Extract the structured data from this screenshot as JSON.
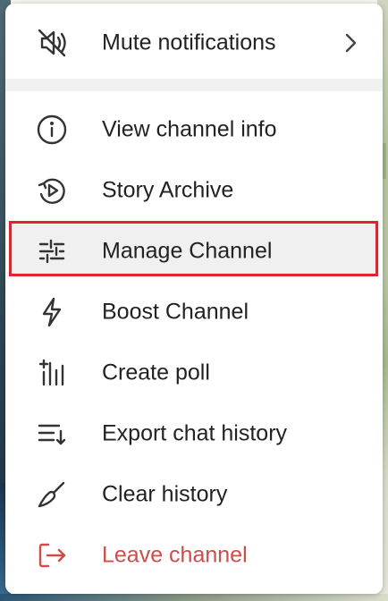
{
  "colors": {
    "text": "#222222",
    "icon": "#333333",
    "danger": "#d14b4b",
    "highlight_border": "#e1222f",
    "highlight_fill": "#f0f0f0"
  },
  "menu": {
    "mute": {
      "label": "Mute notifications",
      "icon": "bell-off-icon",
      "has_submenu": true
    },
    "items": [
      {
        "label": "View channel info",
        "icon": "info-icon"
      },
      {
        "label": "Story Archive",
        "icon": "story-archive-icon"
      },
      {
        "label": "Manage Channel",
        "icon": "sliders-icon",
        "highlighted": true
      },
      {
        "label": "Boost Channel",
        "icon": "lightning-icon"
      },
      {
        "label": "Create poll",
        "icon": "poll-icon"
      },
      {
        "label": "Export chat history",
        "icon": "export-icon"
      },
      {
        "label": "Clear history",
        "icon": "broom-icon"
      },
      {
        "label": "Leave channel",
        "icon": "leave-icon",
        "danger": true
      }
    ]
  }
}
